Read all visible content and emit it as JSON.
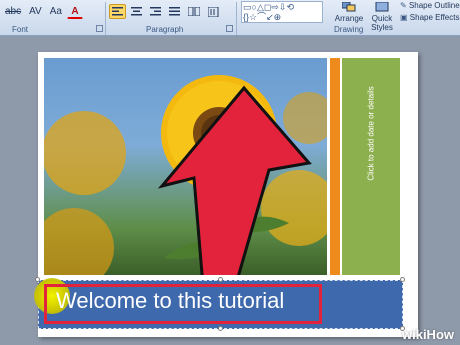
{
  "ribbon": {
    "font_group": {
      "label": "Font",
      "buttons": [
        "abc",
        "AV",
        "Aa",
        "A"
      ]
    },
    "paragraph_group": {
      "label": "Paragraph",
      "buttons": [
        "align-left",
        "align-center",
        "align-right",
        "justify",
        "columns",
        "text-direction"
      ]
    },
    "drawing_group": {
      "label": "Drawing",
      "shapes": [
        "▭",
        "○",
        "△",
        "◻",
        "⇨",
        "⇩",
        "⟲",
        "{",
        "}",
        "☆",
        "⌒",
        "↙",
        "⊕"
      ],
      "arrange_label": "Arrange",
      "quick_styles_label": "Quick Styles",
      "shape_outline_label": "Shape Outline",
      "shape_effects_label": "Shape Effects"
    }
  },
  "slide": {
    "vertical_placeholder": "Click to add date or details",
    "title": "Welcome to this tutorial"
  },
  "watermark": "wikiHow",
  "colors": {
    "orange_bar": "#ef8a1c",
    "green_panel": "#8db04e",
    "title_bg": "#3f69ad",
    "highlight": "#e3233b",
    "arrow": "#e3233b"
  }
}
